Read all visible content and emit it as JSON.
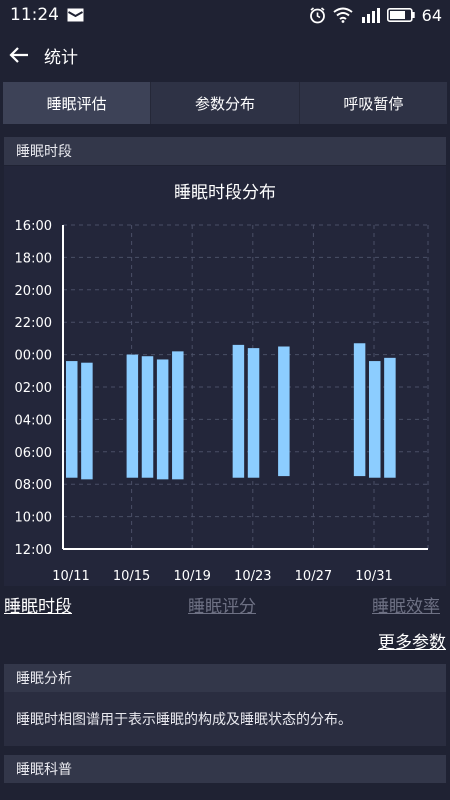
{
  "status_bar": {
    "time": "11:24",
    "battery": "64"
  },
  "app_bar": {
    "title": "统计"
  },
  "tabs": [
    {
      "label": "睡眠评估",
      "active": true
    },
    {
      "label": "参数分布",
      "active": false
    },
    {
      "label": "呼吸暂停",
      "active": false
    }
  ],
  "sleep_period_section": {
    "header": "睡眠时段"
  },
  "chart_data": {
    "type": "bar",
    "title": "睡眠时段分布",
    "y_ticks": [
      "16:00",
      "18:00",
      "20:00",
      "22:00",
      "00:00",
      "02:00",
      "04:00",
      "06:00",
      "08:00",
      "10:00",
      "12:00"
    ],
    "x_ticks": [
      "10/11",
      "10/15",
      "10/19",
      "10/23",
      "10/27",
      "10/31"
    ],
    "ylim_hours": [
      16,
      36
    ],
    "bar_color": "#8ccdff",
    "grid": true,
    "bars": [
      {
        "day": "10/11",
        "start_hour": 24.4,
        "end_hour": 31.6
      },
      {
        "day": "10/12",
        "start_hour": 24.5,
        "end_hour": 31.7
      },
      {
        "day": "10/15",
        "start_hour": 24.0,
        "end_hour": 31.6
      },
      {
        "day": "10/16",
        "start_hour": 24.1,
        "end_hour": 31.6
      },
      {
        "day": "10/17",
        "start_hour": 24.3,
        "end_hour": 31.7
      },
      {
        "day": "10/18",
        "start_hour": 23.8,
        "end_hour": 31.7
      },
      {
        "day": "10/22",
        "start_hour": 23.4,
        "end_hour": 31.6
      },
      {
        "day": "10/23",
        "start_hour": 23.6,
        "end_hour": 31.6
      },
      {
        "day": "10/25",
        "start_hour": 23.5,
        "end_hour": 31.5
      },
      {
        "day": "10/30",
        "start_hour": 23.3,
        "end_hour": 31.5
      },
      {
        "day": "10/31",
        "start_hour": 24.4,
        "end_hour": 31.6
      },
      {
        "day": "11/01",
        "start_hour": 24.2,
        "end_hour": 31.6
      }
    ]
  },
  "sub_tabs": [
    {
      "label": "睡眠时段",
      "active": true
    },
    {
      "label": "睡眠评分",
      "active": false
    },
    {
      "label": "睡眠效率",
      "active": false
    }
  ],
  "more_link": "更多参数",
  "analysis_section": {
    "header": "睡眠分析",
    "body": "睡眠时相图谱用于表示睡眠的构成及睡眠状态的分布。"
  },
  "science_section": {
    "header": "睡眠科普"
  }
}
